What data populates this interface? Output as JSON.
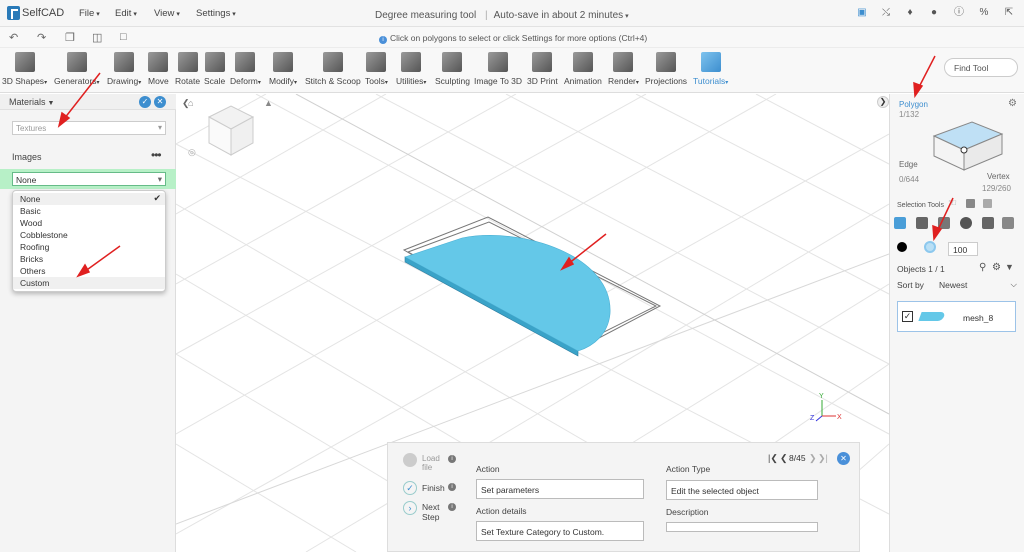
{
  "app": {
    "name": "SelfCAD",
    "brand_color": "#2a7ab8"
  },
  "menus": [
    "File",
    "Edit",
    "View",
    "Settings"
  ],
  "document": {
    "title": "Degree measuring tool",
    "autosave": "Auto-save in about 2 minutes"
  },
  "hint": "Click on polygons to select or click Settings for more options (Ctrl+4)",
  "toolbar": [
    {
      "label": "3D Shapes",
      "dd": true
    },
    {
      "label": "Generators",
      "dd": true
    },
    {
      "label": "Drawing",
      "dd": true
    },
    {
      "label": "Move",
      "dd": false
    },
    {
      "label": "Rotate",
      "dd": false
    },
    {
      "label": "Scale",
      "dd": false
    },
    {
      "label": "Deform",
      "dd": true
    },
    {
      "label": "Modify",
      "dd": true
    },
    {
      "label": "Stitch & Scoop",
      "dd": false
    },
    {
      "label": "Tools",
      "dd": true
    },
    {
      "label": "Utilities",
      "dd": true
    },
    {
      "label": "Sculpting",
      "dd": false
    },
    {
      "label": "Image To 3D",
      "dd": false
    },
    {
      "label": "3D Print",
      "dd": false
    },
    {
      "label": "Animation",
      "dd": false
    },
    {
      "label": "Render",
      "dd": true
    },
    {
      "label": "Projections",
      "dd": false
    },
    {
      "label": "Tutorials",
      "dd": true
    }
  ],
  "find_tool": {
    "placeholder": "Find Tool"
  },
  "left_panel": {
    "title": "Materials",
    "textures_placeholder": "Textures",
    "images_label": "Images",
    "image_select_value": "None",
    "options": [
      "None",
      "Basic",
      "Wood",
      "Cobblestone",
      "Roofing",
      "Bricks",
      "Others",
      "Custom"
    ]
  },
  "right_panel": {
    "mode": "Polygon",
    "polygon_count": "1/132",
    "edge_label": "Edge",
    "edge_count": "0/644",
    "vertex_label": "Vertex",
    "vertex_count": "129/260",
    "selection_tools_label": "Selection Tools",
    "brush_size": "100",
    "objects_label": "Objects 1 / 1",
    "sort_label": "Sort by",
    "sort_value": "Newest",
    "object_name": "mesh_8"
  },
  "instructions": {
    "steps": [
      {
        "label": "Load file"
      },
      {
        "label": "Finish"
      },
      {
        "label": "Next Step"
      }
    ],
    "page": "8/45",
    "action_label": "Action",
    "action_value": "Set parameters",
    "action_type_label": "Action Type",
    "action_type_value": "Edit the selected object",
    "action_details_label": "Action details",
    "action_details_value": "Set Texture Category to Custom.",
    "description_label": "Description"
  },
  "colors": {
    "mesh": "#64c8e8",
    "highlight_row": "#b7f0c7",
    "accent": "#3d8ecf",
    "annotation_arrow": "#e02020"
  }
}
